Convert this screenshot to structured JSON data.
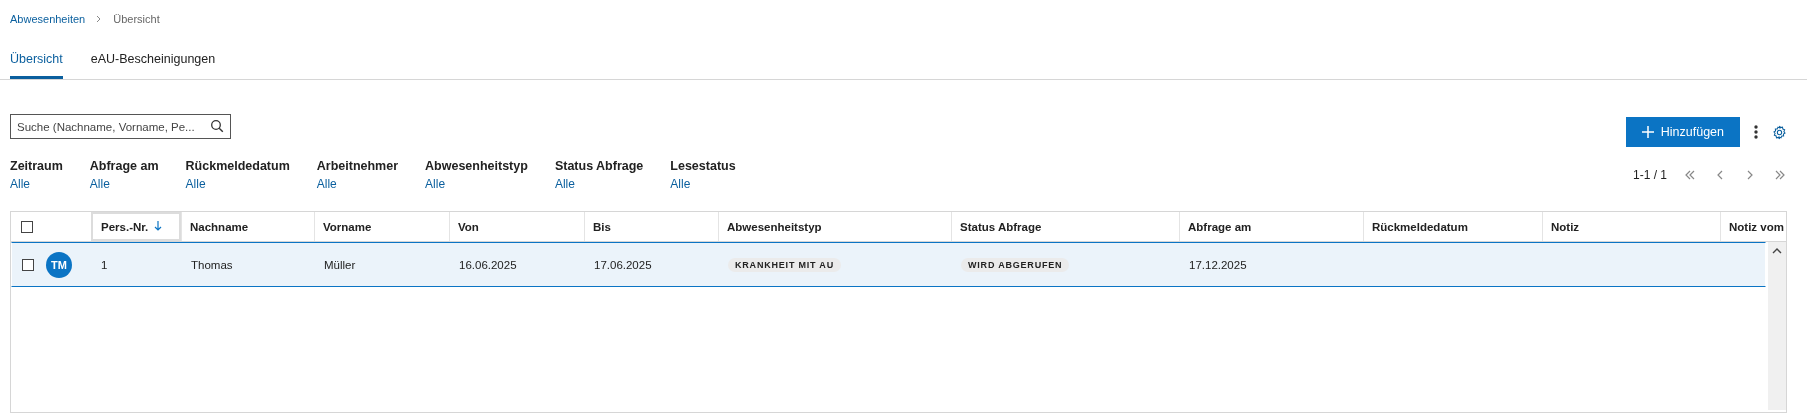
{
  "breadcrumb": [
    {
      "label": "Abwesenheiten",
      "kind": "link"
    },
    {
      "label": "Übersicht",
      "kind": "current"
    }
  ],
  "tabs": [
    {
      "label": "Übersicht",
      "selected": true
    },
    {
      "label": "eAU-Bescheinigungen",
      "selected": false
    }
  ],
  "search": {
    "placeholder": "Suche (Nachname, Vorname, Pe..."
  },
  "add_button": {
    "label": "Hinzufügen"
  },
  "filters": [
    {
      "label": "Zeitraum",
      "value": "Alle"
    },
    {
      "label": "Abfrage am",
      "value": "Alle"
    },
    {
      "label": "Rückmeldedatum",
      "value": "Alle"
    },
    {
      "label": "Arbeitnehmer",
      "value": "Alle"
    },
    {
      "label": "Abwesenheitstyp",
      "value": "Alle"
    },
    {
      "label": "Status Abfrage",
      "value": "Alle"
    },
    {
      "label": "Lesestatus",
      "value": "Alle"
    }
  ],
  "pagination": {
    "range": "1-1 / 1"
  },
  "table": {
    "select_all": {
      "checked": false
    },
    "columns": [
      {
        "label": "Pers.-Nr.",
        "sorted": true
      },
      {
        "label": "Nachname",
        "sorted": false
      },
      {
        "label": "Vorname",
        "sorted": false
      },
      {
        "label": "Von",
        "sorted": false
      },
      {
        "label": "Bis",
        "sorted": false
      },
      {
        "label": "Abwesenheitstyp",
        "sorted": false
      },
      {
        "label": "Status Abfrage",
        "sorted": false
      },
      {
        "label": "Abfrage am",
        "sorted": false
      },
      {
        "label": "Rückmeldedatum",
        "sorted": false
      },
      {
        "label": "Notiz",
        "sorted": false
      },
      {
        "label": "Notiz vom",
        "sorted": false
      }
    ],
    "rows": [
      {
        "selected": true,
        "checked": false,
        "initials": "TM",
        "cells": [
          {
            "kind": "text",
            "value": "1"
          },
          {
            "kind": "text",
            "value": "Thomas"
          },
          {
            "kind": "text",
            "value": "Müller"
          },
          {
            "kind": "text",
            "value": "16.06.2025"
          },
          {
            "kind": "text",
            "value": "17.06.2025"
          },
          {
            "kind": "tag",
            "value": "KRANKHEIT MIT AU"
          },
          {
            "kind": "tag",
            "value": "WIRD ABGERUFEN"
          },
          {
            "kind": "text",
            "value": "17.12.2025"
          },
          {
            "kind": "empty"
          },
          {
            "kind": "empty"
          },
          {
            "kind": "empty"
          }
        ]
      }
    ]
  }
}
